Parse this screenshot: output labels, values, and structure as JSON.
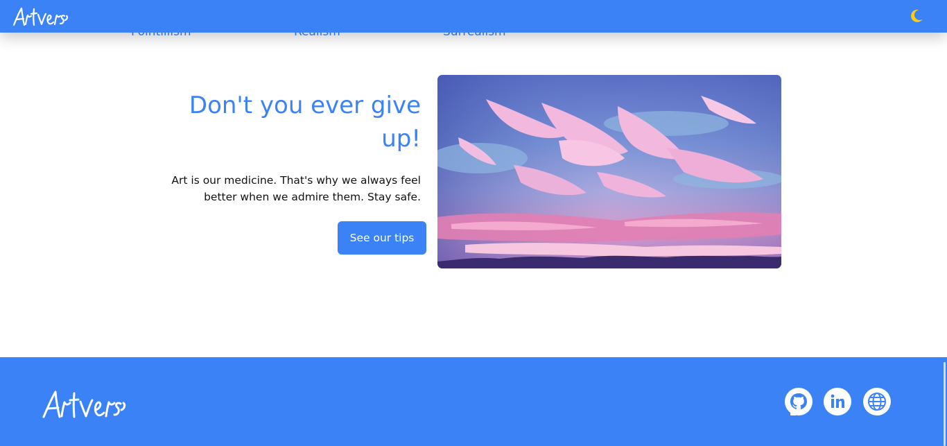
{
  "header": {
    "logo_text": "Artverse",
    "theme_toggle_icon": "moon-icon",
    "theme_toggle_color": "#facc15"
  },
  "categories": [
    {
      "label": "Pointillism"
    },
    {
      "label": "Realism"
    },
    {
      "label": "Surrealism"
    }
  ],
  "hero": {
    "title": "Don't you ever give up!",
    "description": "Art is our medicine. That's why we always feel better when we admire them. Stay safe.",
    "cta_label": "See our tips",
    "image_icon": "sky-clouds-image"
  },
  "footer": {
    "logo_text": "Artverse",
    "social": [
      {
        "icon": "github-icon"
      },
      {
        "icon": "linkedin-icon"
      },
      {
        "icon": "globe-icon"
      }
    ]
  },
  "colors": {
    "brand": "#3b82f6",
    "text": "#111111",
    "background": "#ffffff"
  }
}
